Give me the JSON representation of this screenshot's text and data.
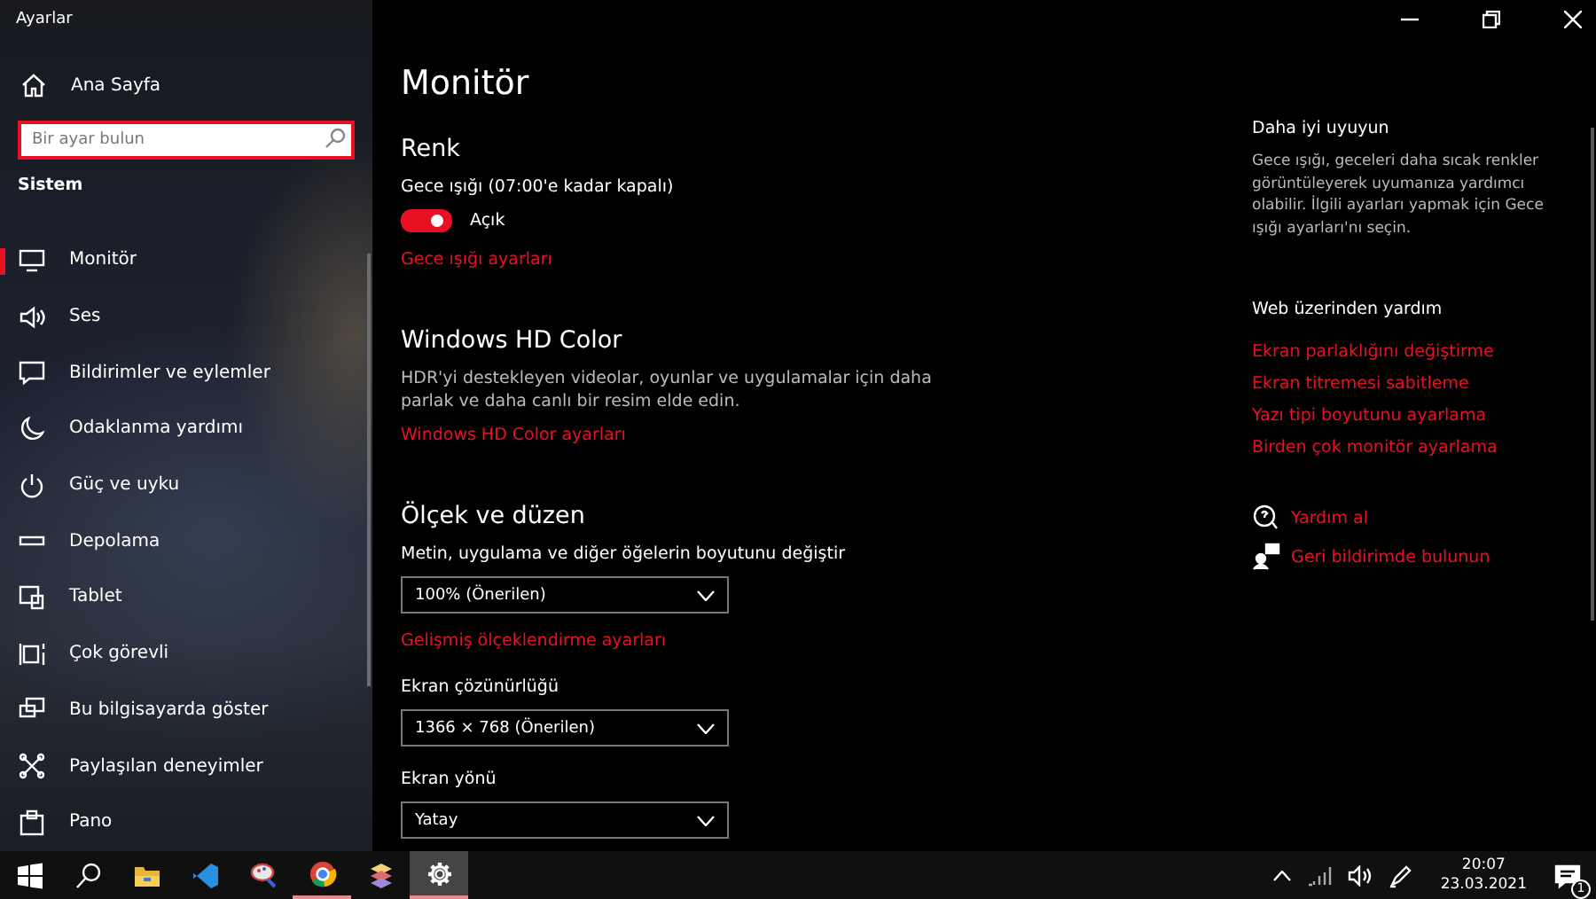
{
  "window": {
    "title": "Ayarlar"
  },
  "sidebar": {
    "home": "Ana Sayfa",
    "search": {
      "placeholder": "Bir ayar bulun"
    },
    "section": "Sistem",
    "items": [
      {
        "label": "Monitör",
        "kind": "display",
        "selected": true
      },
      {
        "label": "Ses",
        "kind": "sound",
        "selected": false
      },
      {
        "label": "Bildirimler ve eylemler",
        "kind": "notification",
        "selected": false
      },
      {
        "label": "Odaklanma yardımı",
        "kind": "moon",
        "selected": false
      },
      {
        "label": "Güç ve uyku",
        "kind": "power",
        "selected": false
      },
      {
        "label": "Depolama",
        "kind": "storage",
        "selected": false
      },
      {
        "label": "Tablet",
        "kind": "tablet",
        "selected": false
      },
      {
        "label": "Çok görevli",
        "kind": "multitask",
        "selected": false
      },
      {
        "label": "Bu bilgisayarda göster",
        "kind": "project",
        "selected": false
      },
      {
        "label": "Paylaşılan deneyimler",
        "kind": "share",
        "selected": false
      },
      {
        "label": "Pano",
        "kind": "clipboard",
        "selected": false
      }
    ]
  },
  "main": {
    "title": "Monitör",
    "content": [
      {
        "kind": "heading",
        "text": "Renk"
      },
      {
        "kind": "label",
        "text": "Gece ışığı (07:00'e kadar kapalı)"
      },
      {
        "kind": "toggle",
        "text": "Açık",
        "on": true
      },
      {
        "kind": "link",
        "text": "Gece ışığı ayarları"
      },
      {
        "kind": "heading",
        "text": "Windows HD Color"
      },
      {
        "kind": "text",
        "text": "HDR'yi destekleyen videolar, oyunlar ve uygulamalar için daha parlak ve daha canlı bir resim elde edin."
      },
      {
        "kind": "link",
        "text": "Windows HD Color ayarları"
      },
      {
        "kind": "heading",
        "text": "Ölçek ve düzen"
      },
      {
        "kind": "label",
        "text": "Metin, uygulama ve diğer öğelerin boyutunu değiştir"
      },
      {
        "kind": "dropdown",
        "text": "100% (Önerilen)"
      },
      {
        "kind": "link",
        "text": "Gelişmiş ölçeklendirme ayarları"
      },
      {
        "kind": "label",
        "text": "Ekran çözünürlüğü"
      },
      {
        "kind": "dropdown",
        "text": "1366 × 768 (Önerilen)"
      },
      {
        "kind": "label",
        "text": "Ekran yönü"
      },
      {
        "kind": "dropdown",
        "text": "Yatay"
      }
    ]
  },
  "aside": {
    "tip_title": "Daha iyi uyuyun",
    "tip_text": "Gece ışığı, geceleri daha sıcak renkler görüntüleyerek uyumanıza yardımcı olabilir. İlgili ayarları yapmak için Gece ışığı ayarları'nı seçin.",
    "web_title": "Web üzerinden yardım",
    "web_links": [
      "Ekran parlaklığını değiştirme",
      "Ekran titremesi sabitleme",
      "Yazı tipi boyutunu ayarlama",
      "Birden çok monitör ayarlama"
    ],
    "actions": [
      {
        "kind": "help",
        "text": "Yardım al"
      },
      {
        "kind": "feedback",
        "text": "Geri bildirimde bulunun"
      }
    ]
  },
  "taskbar": {
    "apps": [
      {
        "kind": "start",
        "running": false,
        "selected": false
      },
      {
        "kind": "search",
        "running": false,
        "selected": false
      },
      {
        "kind": "folder",
        "running": false,
        "selected": false
      },
      {
        "kind": "code",
        "running": false,
        "selected": false
      },
      {
        "kind": "paint",
        "running": false,
        "selected": false
      },
      {
        "kind": "browser",
        "running": true,
        "selected": false
      },
      {
        "kind": "stack",
        "running": false,
        "selected": false
      },
      {
        "kind": "settings",
        "running": true,
        "selected": true
      }
    ],
    "time": "20:07",
    "date": "23.03.2021",
    "notifications": "1"
  }
}
